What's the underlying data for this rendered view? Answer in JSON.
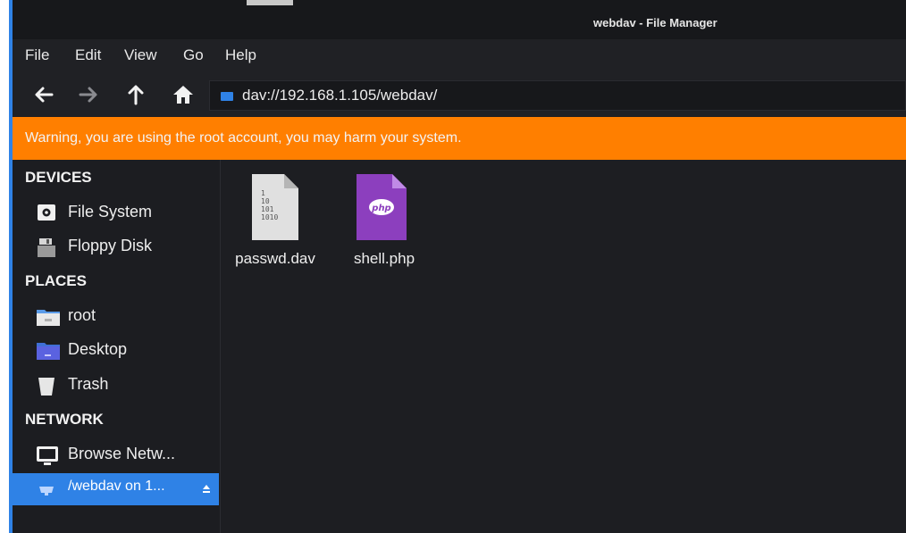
{
  "window": {
    "title": "webdav - File Manager"
  },
  "menubar": {
    "items": [
      "File",
      "Edit",
      "View",
      "Go",
      "Help"
    ]
  },
  "toolbar": {
    "address": "dav://192.168.1.105/webdav/"
  },
  "warning": {
    "text": "Warning, you are using the root account, you may harm your system."
  },
  "sidebar": {
    "devices_heading": "DEVICES",
    "devices": [
      "File System",
      "Floppy Disk"
    ],
    "places_heading": "PLACES",
    "places": [
      "root",
      "Desktop",
      "Trash"
    ],
    "network_heading": "NETWORK",
    "network": [
      "Browse Netw...",
      "/webdav on 1..."
    ]
  },
  "files": [
    {
      "name": "passwd.dav",
      "icon": "binary-file-icon",
      "icon_text": [
        "1",
        "10",
        "101",
        "1010"
      ]
    },
    {
      "name": "shell.php",
      "icon": "php-file-icon",
      "icon_text": "php"
    }
  ],
  "colors": {
    "accent": "#2f82e6",
    "warning": "#ff7f00",
    "php": "#8c3fbe"
  }
}
